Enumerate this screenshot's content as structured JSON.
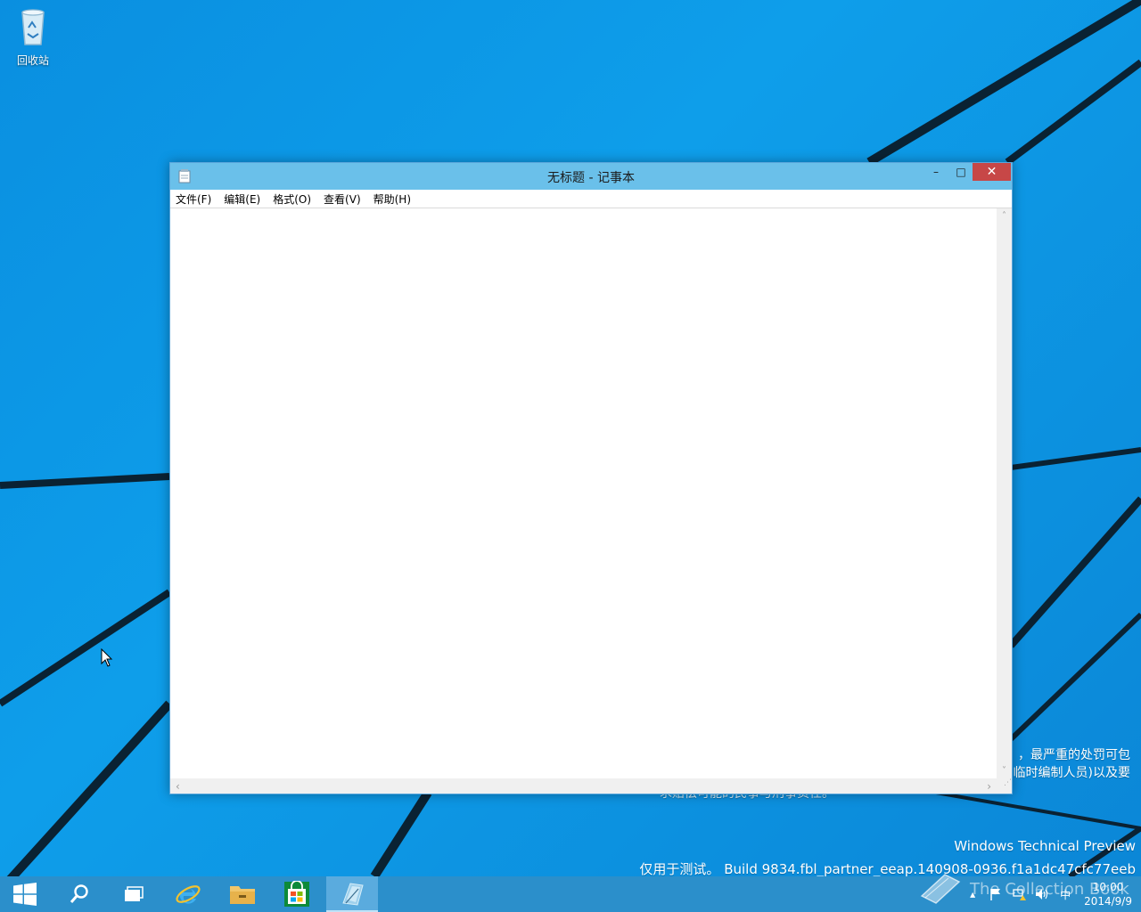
{
  "desktop": {
    "icon_label": "回收站",
    "watermark": {
      "legal_line1": "，最严重的处罚可包",
      "legal_line2": "临时编制人员)以及要",
      "legal_line3": "求赔偿可能的民事与刑事责任。",
      "title": "Windows Technical Preview",
      "build": "仅用于测试。 Build 9834.fbl_partner_eeap.140908-0936.f1a1dc47cfc77eeb",
      "overlay": "The Collection Book"
    }
  },
  "window": {
    "title": "无标题 - 记事本",
    "controls": {
      "minimize": "–",
      "maximize": "□",
      "close": "✕"
    },
    "menu": [
      "文件(F)",
      "编辑(E)",
      "格式(O)",
      "查看(V)",
      "帮助(H)"
    ],
    "content": ""
  },
  "taskbar": {
    "apps": [
      "start-icon",
      "search-icon",
      "task-view-icon",
      "internet-explorer-icon",
      "file-explorer-icon",
      "store-icon",
      "notepad-icon"
    ],
    "tray": {
      "ime": "中",
      "time": "10:00",
      "date": "2014/9/9"
    }
  },
  "colors": {
    "titlebar": "#6ac0ea",
    "close_button": "#c74747",
    "taskbar": "#2b8fcb",
    "desktop": "#0e9eea"
  }
}
